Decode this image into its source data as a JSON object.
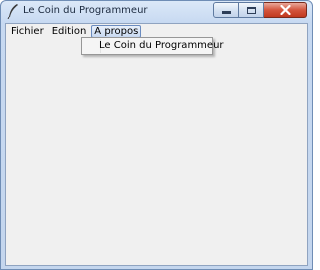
{
  "window": {
    "title": "Le Coin du Programmeur",
    "controls": [
      "minimize-icon",
      "maximize-icon",
      "close-icon"
    ],
    "close_color": "#c7432a"
  },
  "menubar": {
    "items": [
      {
        "label": "Fichier"
      },
      {
        "label": "Edition"
      },
      {
        "label": "A propos"
      }
    ],
    "open_menu": "A propos"
  },
  "dropdown": {
    "items": [
      {
        "label": "Le Coin du Programmeur"
      }
    ]
  }
}
